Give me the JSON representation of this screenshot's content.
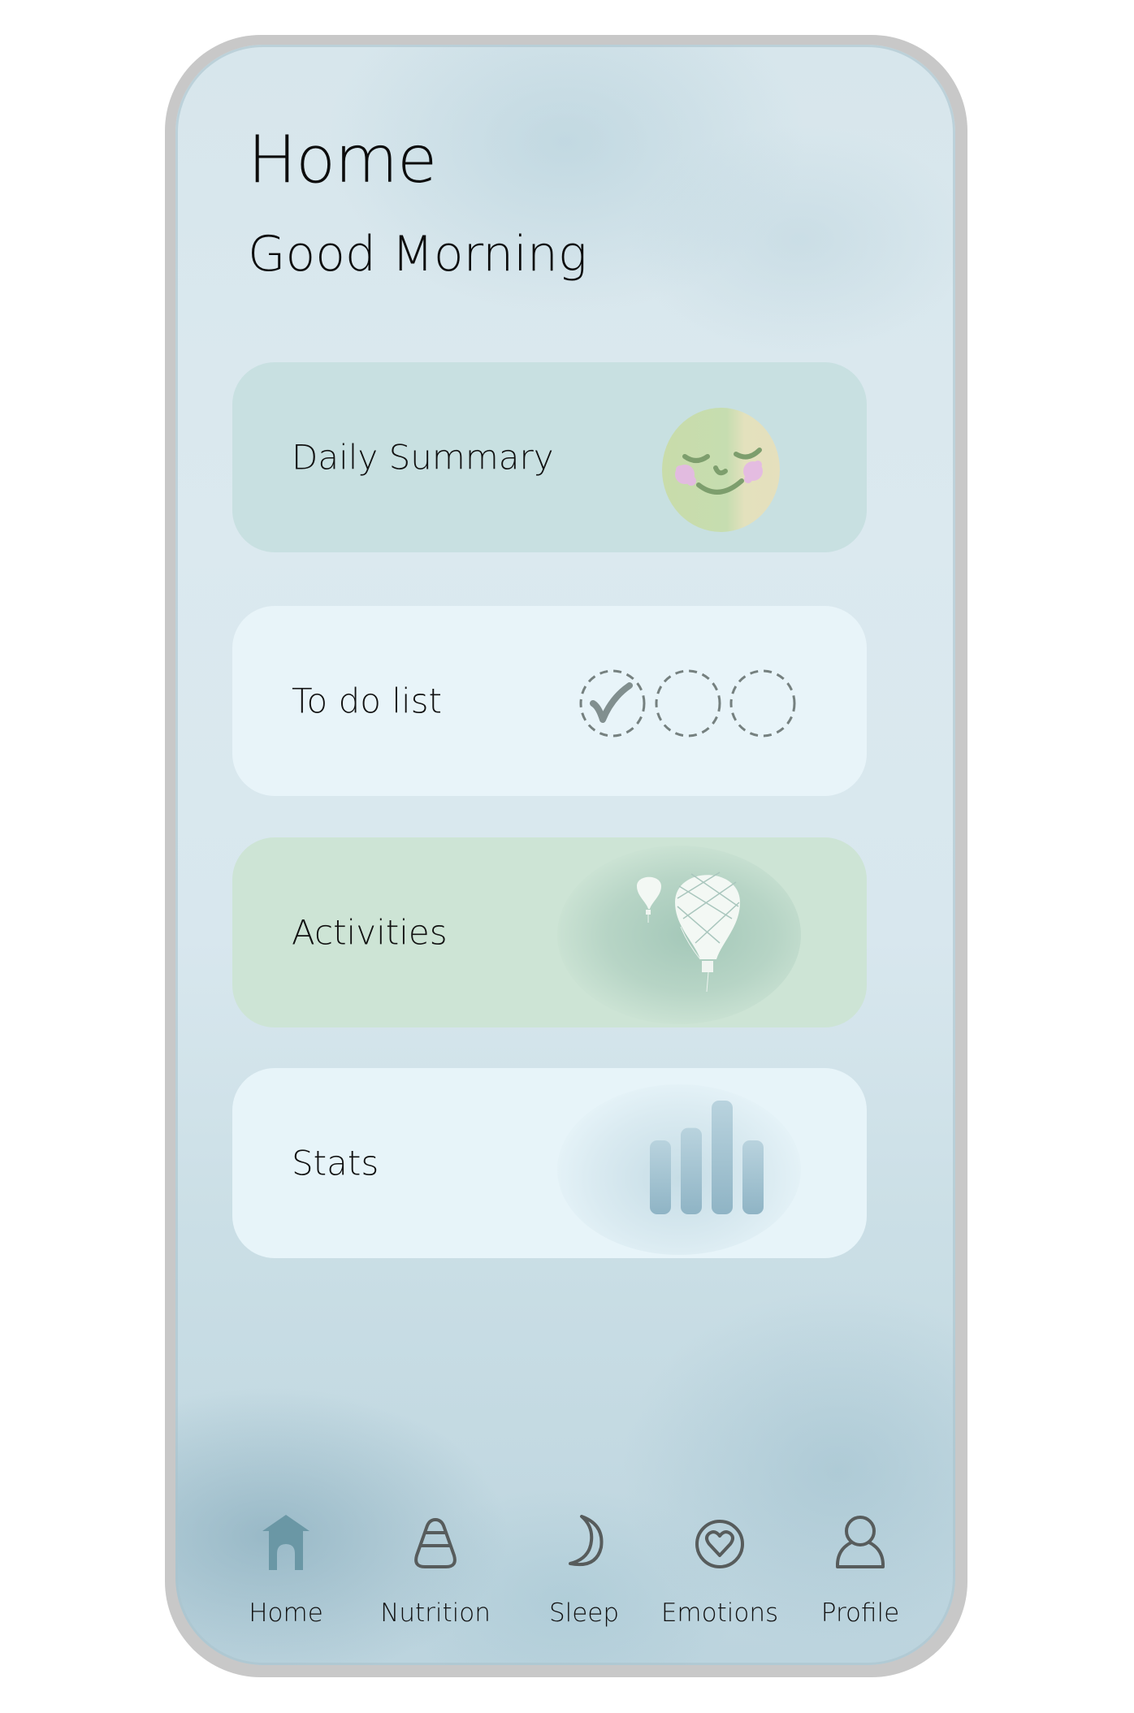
{
  "header": {
    "title": "Home",
    "greeting": "Good Morning"
  },
  "cards": [
    {
      "label": "Daily Summary",
      "icon": "smiling-face-icon"
    },
    {
      "label": "To do list",
      "icon": "checklist-circles-icon",
      "todos": [
        {
          "done": true
        },
        {
          "done": false
        },
        {
          "done": false
        }
      ]
    },
    {
      "label": "Activities",
      "icon": "hot-air-balloon-icon"
    },
    {
      "label": "Stats",
      "icon": "bar-chart-icon",
      "bar_levels": [
        0.65,
        0.76,
        1.0,
        0.65
      ]
    }
  ],
  "bottom_nav": {
    "active": "Home",
    "items": [
      {
        "label": "Home",
        "icon": "house-icon"
      },
      {
        "label": "Nutrition",
        "icon": "candy-corn-icon"
      },
      {
        "label": "Sleep",
        "icon": "moon-icon"
      },
      {
        "label": "Emotions",
        "icon": "heart-circle-icon"
      },
      {
        "label": "Profile",
        "icon": "person-icon"
      }
    ]
  },
  "colors": {
    "active_nav": "#6a97a5",
    "inactive_nav": "#575c5c",
    "card_summary": "#c8e0e1",
    "card_todo": "#e8f4f9",
    "card_activities": "#cde4d5",
    "card_stats": "#e7f4f9"
  }
}
